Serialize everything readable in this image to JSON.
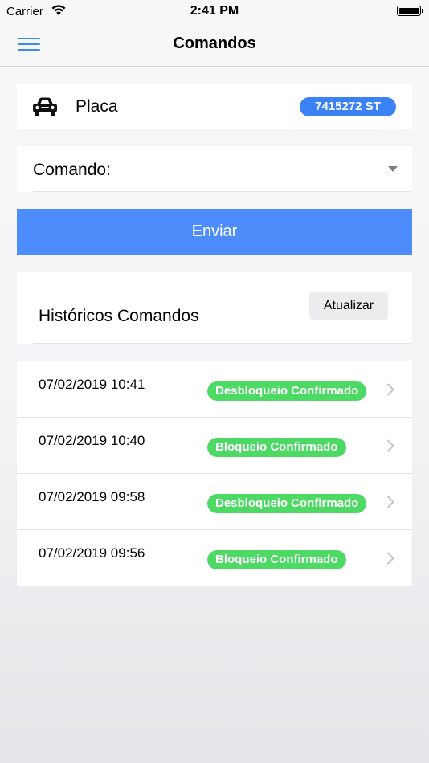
{
  "status_bar": {
    "carrier": "Carrier",
    "time": "2:41 PM"
  },
  "nav": {
    "title": "Comandos",
    "menu_icon": "hamburger-menu-icon"
  },
  "placa": {
    "label": "Placa",
    "plate": "7415272 ST",
    "icon": "car-icon"
  },
  "comando": {
    "label": "Comando:",
    "selected": ""
  },
  "send_button": {
    "label": "Enviar"
  },
  "history": {
    "title": "Históricos Comandos",
    "refresh_label": "Atualizar",
    "rows": [
      {
        "date": "07/02/2019 10:41",
        "status": "Desbloqueio Confirmado"
      },
      {
        "date": "07/02/2019 10:40",
        "status": "Bloqueio Confirmado"
      },
      {
        "date": "07/02/2019 09:58",
        "status": "Desbloqueio Confirmado"
      },
      {
        "date": "07/02/2019 09:56",
        "status": "Bloqueio Confirmado"
      }
    ]
  },
  "colors": {
    "accent": "#4d8dfb",
    "plate_badge": "#3b82f6",
    "status_confirmed": "#4cd964",
    "nav_icon": "#3b8af0"
  }
}
